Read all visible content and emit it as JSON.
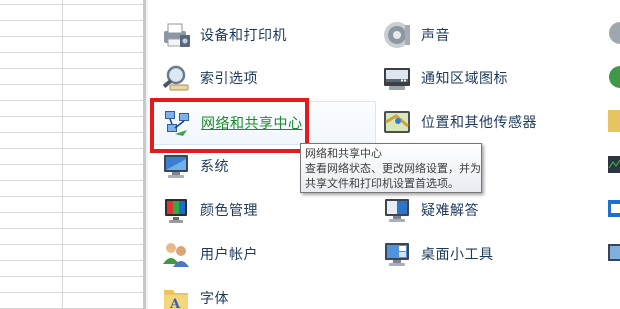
{
  "control_panel": {
    "items_left": [
      {
        "id": "devices-printers",
        "label": "设备和打印机",
        "icon": "printer-icon"
      },
      {
        "id": "indexing-options",
        "label": "索引选项",
        "icon": "magnifier-icon"
      },
      {
        "id": "network-sharing-center",
        "label": "网络和共享中心",
        "icon": "network-icon"
      },
      {
        "id": "system",
        "label": "系统",
        "icon": "computer-icon"
      },
      {
        "id": "color-management",
        "label": "颜色管理",
        "icon": "color-monitor-icon"
      },
      {
        "id": "user-accounts",
        "label": "用户帐户",
        "icon": "users-icon"
      },
      {
        "id": "fonts",
        "label": "字体",
        "icon": "font-folder-icon"
      }
    ],
    "items_right": [
      {
        "id": "sound",
        "label": "声音",
        "icon": "speaker-icon"
      },
      {
        "id": "notification-area-icons",
        "label": "通知区域图标",
        "icon": "taskbar-icon"
      },
      {
        "id": "location-sensors",
        "label": "位置和其他传感器",
        "icon": "map-sensor-icon"
      },
      {
        "id": "troubleshooting",
        "label": "疑难解答",
        "icon": "troubleshoot-monitor-icon"
      },
      {
        "id": "desktop-gadgets",
        "label": "桌面小工具",
        "icon": "gadget-monitor-icon"
      }
    ],
    "hovered_item": "network-sharing-center"
  },
  "tooltip": {
    "title": "网络和共享中心",
    "line1": "查看网络状态、更改网络设置，并为",
    "line2": "共享文件和打印机设置首选项。"
  },
  "colors": {
    "link_text": "#1e395b",
    "hover_text": "#1a8a2a",
    "highlight_border": "#e51a1a"
  }
}
